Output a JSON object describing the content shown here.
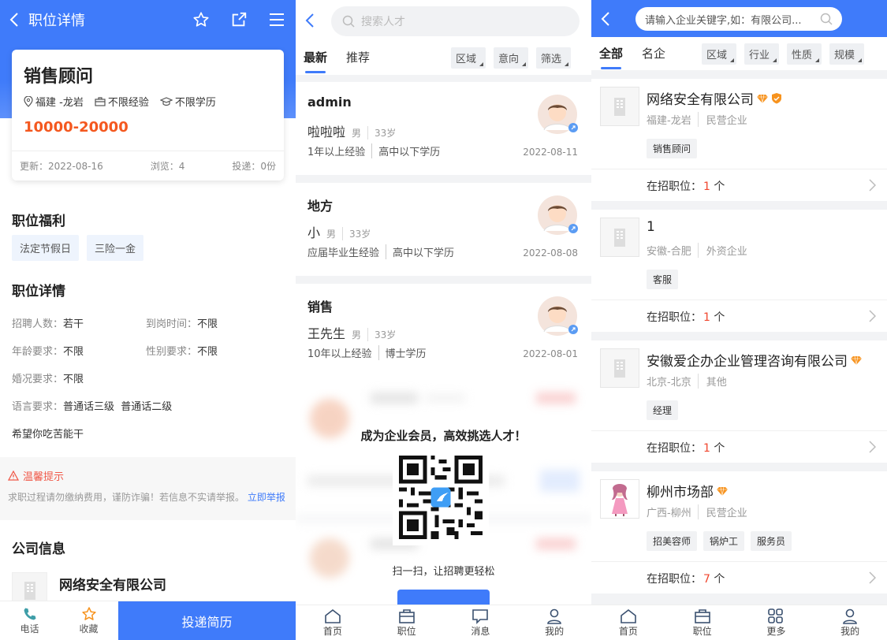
{
  "job": {
    "header_title": "职位详情",
    "title": "销售顾问",
    "location": "福建 -龙岩",
    "experience": "不限经验",
    "education": "不限学历",
    "salary": "10000-20000",
    "updated": "更新：2022-08-16",
    "views": "浏览：4",
    "applications": "投递：0份",
    "benefits_title": "职位福利",
    "benefits": [
      "法定节假日",
      "三险一金"
    ],
    "details_title": "职位详情",
    "details": [
      {
        "k": "招聘人数：",
        "v": "若干",
        "k2": "到岗时间：",
        "v2": "不限"
      },
      {
        "k": "年龄要求：",
        "v": "不限",
        "k2": "性别要求：",
        "v2": "不限"
      },
      {
        "k": "婚况要求：",
        "v": "不限",
        "k2": "",
        "v2": ""
      },
      {
        "k": "语言要求：",
        "v": "普通话三级  普通话二级",
        "k2": "",
        "v2": ""
      }
    ],
    "description": "希望你吃苦能干",
    "tip_title": "温馨提示",
    "tip_text": "求职过程请勿缴纳费用，谨防诈骗！若信息不实请举报。",
    "tip_link": "立即举报",
    "company_title": "公司信息",
    "company_name": "网络安全有限公司",
    "bottom": {
      "call": "电话",
      "fav": "收藏",
      "apply": "投递简历"
    }
  },
  "talents": {
    "search_placeholder": "搜索人才",
    "tabs": [
      "最新",
      "推荐"
    ],
    "filters": [
      "区域",
      "意向",
      "筛选"
    ],
    "items": [
      {
        "title": "admin",
        "name": "啦啦啦",
        "gender": "男",
        "age": "33岁",
        "exp": "1年以上经验",
        "edu": "高中以下学历",
        "date": "2022-08-11"
      },
      {
        "title": "地方",
        "name": "小",
        "gender": "男",
        "age": "33岁",
        "exp": "应届毕业生经验",
        "edu": "高中以下学历",
        "date": "2022-08-08"
      },
      {
        "title": "销售",
        "name": "王先生",
        "gender": "男",
        "age": "33岁",
        "exp": "10年以上经验",
        "edu": "博士学历",
        "date": "2022-08-01"
      }
    ],
    "promo_title": "成为企业会员，高效挑选人才！",
    "promo_sub": "扫一扫，让招聘更轻松",
    "tabbar": [
      "首页",
      "职位",
      "消息",
      "我的"
    ]
  },
  "companies": {
    "search_placeholder": "请输入企业关键字,如：有限公司...",
    "tabs": [
      "全部",
      "名企"
    ],
    "filters": [
      "区域",
      "行业",
      "性质",
      "规模"
    ],
    "hiring_label": "在招职位：",
    "unit": "个",
    "items": [
      {
        "name": "网络安全有限公司",
        "loc": "福建-龙岩",
        "type": "民营企业",
        "tags": [
          "销售顾问"
        ],
        "count": "1"
      },
      {
        "name": "1",
        "loc": "安徽-合肥",
        "type": "外资企业",
        "tags": [
          "客服"
        ],
        "count": "1"
      },
      {
        "name": "安徽爱企办企业管理咨询有限公司",
        "loc": "北京-北京",
        "type": "其他",
        "tags": [
          "经理"
        ],
        "count": "1"
      },
      {
        "name": "柳州市场部",
        "loc": "广西-柳州",
        "type": "民营企业",
        "tags": [
          "招美容师",
          "锅炉工",
          "服务员"
        ],
        "count": "7"
      }
    ],
    "tabbar": [
      "首页",
      "职位",
      "更多",
      "我的"
    ]
  },
  "colors": {
    "primary": "#3f7bfa",
    "salary": "#f4581f",
    "count": "#f0462e",
    "diamond": "#f7931e"
  }
}
